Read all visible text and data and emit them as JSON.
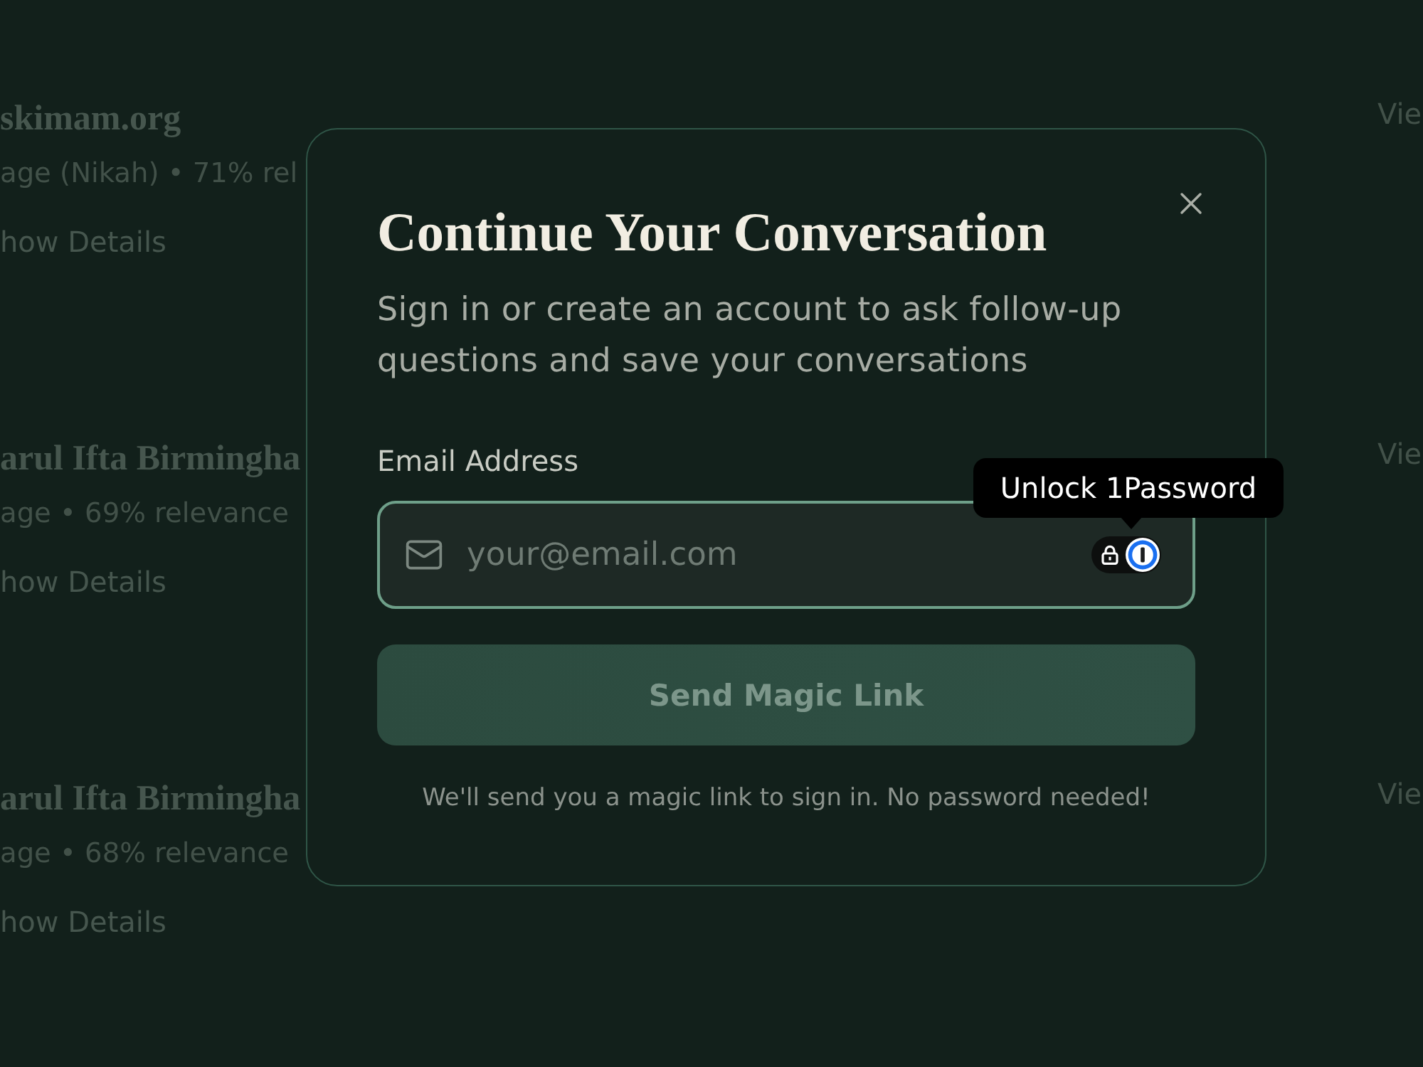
{
  "results": [
    {
      "title": "skimam.org",
      "meta": "age (Nikah) • 71% rel",
      "details_link": "how Details",
      "view_link": "Vie"
    },
    {
      "title": "arul Ifta Birmingha",
      "meta": "age • 69% relevance",
      "details_link": "how Details",
      "view_link": "Vie"
    },
    {
      "title": "arul Ifta Birmingha",
      "meta": "age • 68% relevance",
      "details_link": "how Details",
      "view_link": "Vie"
    }
  ],
  "dialog": {
    "title": "Continue Your Conversation",
    "subtitle": "Sign in or create an account to ask follow-up questions and save your conversations",
    "email": {
      "label": "Email Address",
      "placeholder": "your@email.com",
      "focused": true
    },
    "password_manager": {
      "tooltip": "Unlock 1Password"
    },
    "submit": {
      "label": "Send Magic Link",
      "disabled": true
    },
    "note": "We'll send you a magic link to sign in. No password needed!"
  }
}
